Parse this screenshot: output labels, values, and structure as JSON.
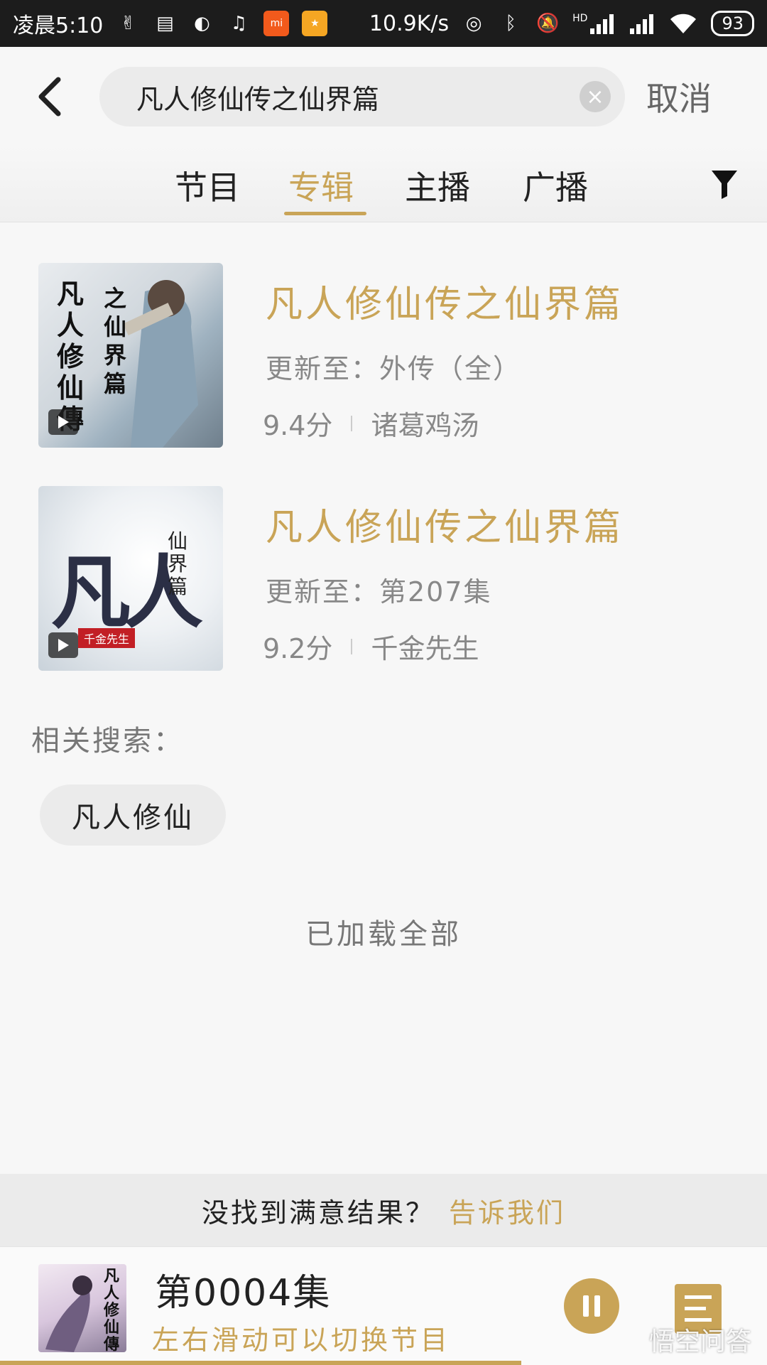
{
  "status_bar": {
    "time": "凌晨5:10",
    "net_speed": "10.9K/s",
    "battery": "93",
    "hd_label": "HD"
  },
  "search": {
    "query": "凡人修仙传之仙界篇",
    "cancel_label": "取消"
  },
  "tabs": [
    {
      "label": "节目",
      "active": false
    },
    {
      "label": "专辑",
      "active": true
    },
    {
      "label": "主播",
      "active": false
    },
    {
      "label": "广播",
      "active": false
    }
  ],
  "results": [
    {
      "title": "凡人修仙传之仙界篇",
      "update": "更新至：外传（全）",
      "score": "9.4分",
      "author": "诸葛鸡汤",
      "cover_text": [
        "凡人修仙傳",
        "之仙界篇"
      ]
    },
    {
      "title": "凡人修仙传之仙界篇",
      "update": "更新至：第207集",
      "score": "9.2分",
      "author": "千金先生",
      "cover_text": [
        "凡人",
        "仙界篇",
        "千金先生"
      ]
    }
  ],
  "related": {
    "label": "相关搜索：",
    "chips": [
      "凡人修仙"
    ]
  },
  "loaded_all": "已加载全部",
  "feedback": {
    "text": "没找到满意结果？",
    "link": "告诉我们"
  },
  "player": {
    "title": "第0004集",
    "hint": "左右滑动可以切换节目",
    "cover_text": "凡人修仙傳",
    "progress": 0.68
  },
  "watermark": "悟空问答",
  "colors": {
    "accent": "#c9a457",
    "status_bar_bg": "#1c1c1c"
  }
}
